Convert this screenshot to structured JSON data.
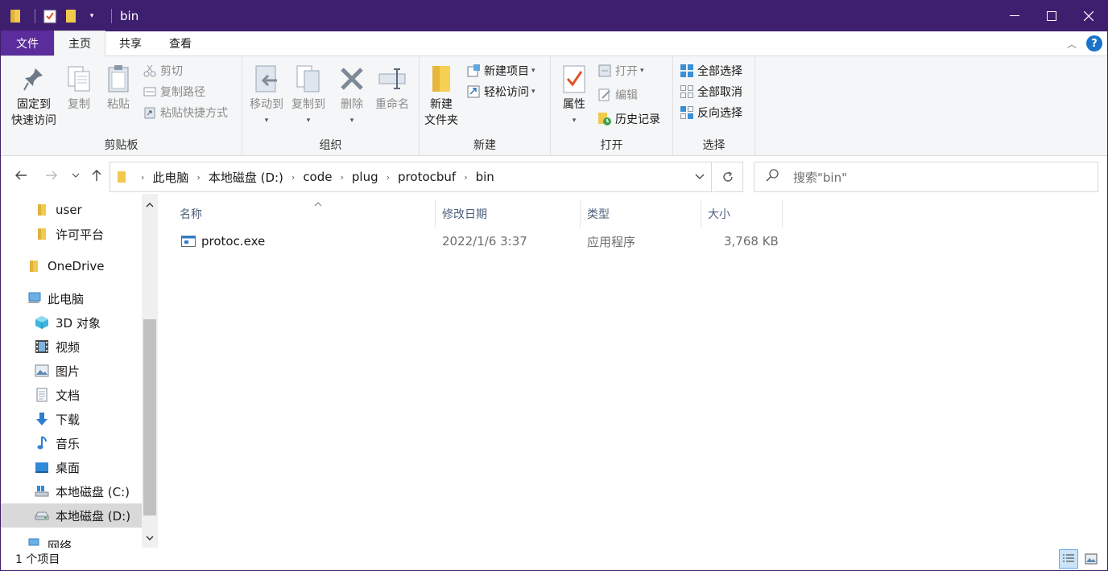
{
  "window": {
    "title": "bin"
  },
  "tabs": {
    "file": "文件",
    "home": "主页",
    "share": "共享",
    "view": "查看"
  },
  "ribbon": {
    "clipboard": {
      "label": "剪贴板",
      "pin_line1": "固定到",
      "pin_line2": "快速访问",
      "copy": "复制",
      "paste": "粘贴",
      "cut": "剪切",
      "copy_path": "复制路径",
      "paste_shortcut": "粘贴快捷方式"
    },
    "organize": {
      "label": "组织",
      "move_to": "移动到",
      "copy_to": "复制到",
      "delete": "删除",
      "rename": "重命名"
    },
    "new": {
      "label": "新建",
      "new_folder_line1": "新建",
      "new_folder_line2": "文件夹",
      "new_item": "新建项目",
      "easy_access": "轻松访问"
    },
    "open": {
      "label": "打开",
      "properties": "属性",
      "open": "打开",
      "edit": "编辑",
      "history": "历史记录"
    },
    "select": {
      "label": "选择",
      "select_all": "全部选择",
      "select_none": "全部取消",
      "invert": "反向选择"
    }
  },
  "address": {
    "crumbs": [
      "此电脑",
      "本地磁盘 (D:)",
      "code",
      "plug",
      "protocbuf",
      "bin"
    ],
    "search_placeholder": "搜索\"bin\""
  },
  "nav_pane": {
    "items": [
      {
        "label": "user",
        "icon": "folder-icon"
      },
      {
        "label": "许可平台",
        "icon": "folder-icon"
      },
      {
        "label": "OneDrive",
        "icon": "folder-icon"
      },
      {
        "label": "此电脑",
        "icon": "computer-icon"
      },
      {
        "label": "3D 对象",
        "icon": "cube-icon"
      },
      {
        "label": "视频",
        "icon": "film-icon"
      },
      {
        "label": "图片",
        "icon": "picture-icon"
      },
      {
        "label": "文档",
        "icon": "document-icon"
      },
      {
        "label": "下载",
        "icon": "download-icon"
      },
      {
        "label": "音乐",
        "icon": "music-icon"
      },
      {
        "label": "桌面",
        "icon": "desktop-icon"
      },
      {
        "label": "本地磁盘 (C:)",
        "icon": "drive-c-icon"
      },
      {
        "label": "本地磁盘 (D:)",
        "icon": "drive-d-icon"
      },
      {
        "label": "网络",
        "icon": "network-icon"
      }
    ]
  },
  "columns": {
    "name": "名称",
    "date": "修改日期",
    "type": "类型",
    "size": "大小"
  },
  "files": [
    {
      "name": "protoc.exe",
      "date": "2022/1/6 3:37",
      "type": "应用程序",
      "size": "3,768 KB"
    }
  ],
  "status": {
    "count": "1 个项目"
  },
  "colors": {
    "titlebar": "#3e1f6f",
    "file_tab": "#5b2c9c",
    "help": "#1a73c9"
  }
}
